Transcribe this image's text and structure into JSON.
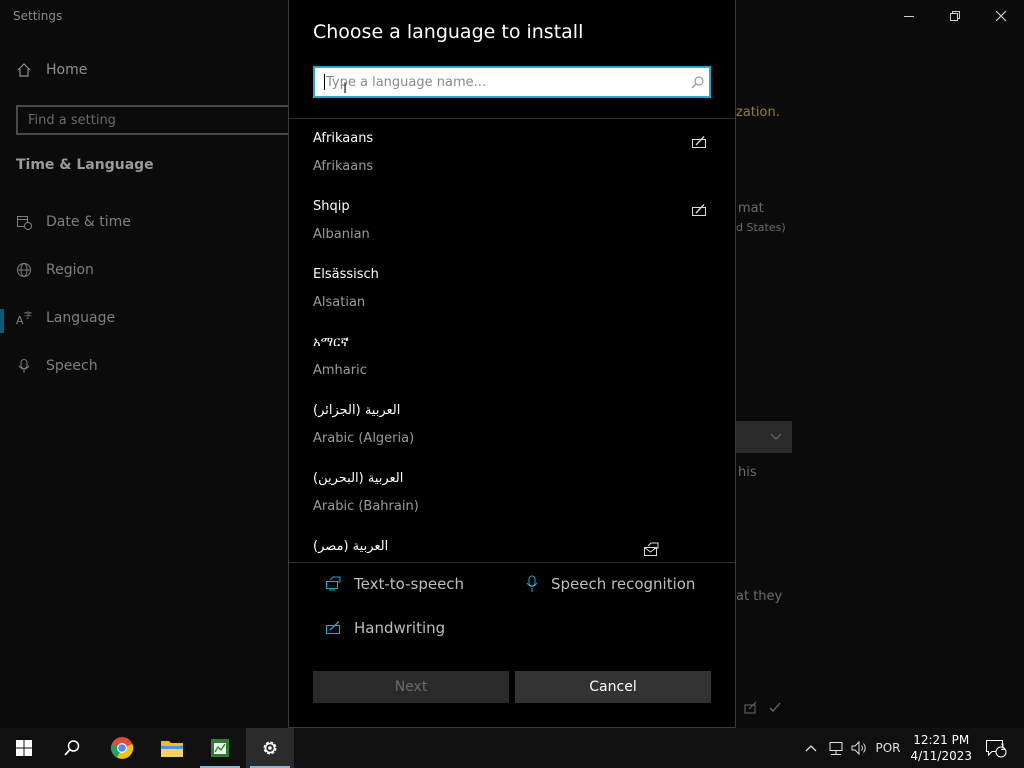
{
  "window": {
    "title": "Settings"
  },
  "nav": {
    "home": "Home",
    "search_placeholder": "Find a setting",
    "section": "Time & Language",
    "items": [
      {
        "label": "Date & time",
        "icon": "calendar-clock-icon"
      },
      {
        "label": "Region",
        "icon": "globe-icon"
      },
      {
        "label": "Language",
        "icon": "language-icon"
      },
      {
        "label": "Speech",
        "icon": "microphone-icon"
      }
    ]
  },
  "background": {
    "accent_text": "zation.",
    "text_mat": "mat",
    "text_states": "d States)",
    "text_his": "his",
    "text_at_they": "at they"
  },
  "dialog": {
    "title": "Choose a language to install",
    "search_placeholder": "Type a language name...",
    "languages": [
      {
        "native": "Afrikaans",
        "english": "Afrikaans",
        "feature_icon": "handwriting-icon"
      },
      {
        "native": "Shqip",
        "english": "Albanian",
        "feature_icon": "handwriting-icon"
      },
      {
        "native": "Elsässisch",
        "english": "Alsatian",
        "feature_icon": ""
      },
      {
        "native": "አማርኛ",
        "english": "Amharic",
        "feature_icon": ""
      },
      {
        "native": "العربية (الجزائر)",
        "english": "Arabic (Algeria)",
        "feature_icon": ""
      },
      {
        "native": "العربية (البحرين)",
        "english": "Arabic (Bahrain)",
        "feature_icon": ""
      },
      {
        "native": "العربية (مصر)",
        "english": "",
        "feature_icon": "text-to-speech-icon"
      }
    ],
    "legend": {
      "tts": "Text-to-speech",
      "speech": "Speech recognition",
      "handwriting": "Handwriting"
    },
    "next": "Next",
    "cancel": "Cancel"
  },
  "taskbar": {
    "lang": "POR",
    "time": "12:21 PM",
    "date": "4/11/2023",
    "notifications": "1"
  },
  "colors": {
    "accent": "#2aa8c8",
    "dialog_bg": "#000000",
    "taskbar_bg": "#101010"
  }
}
